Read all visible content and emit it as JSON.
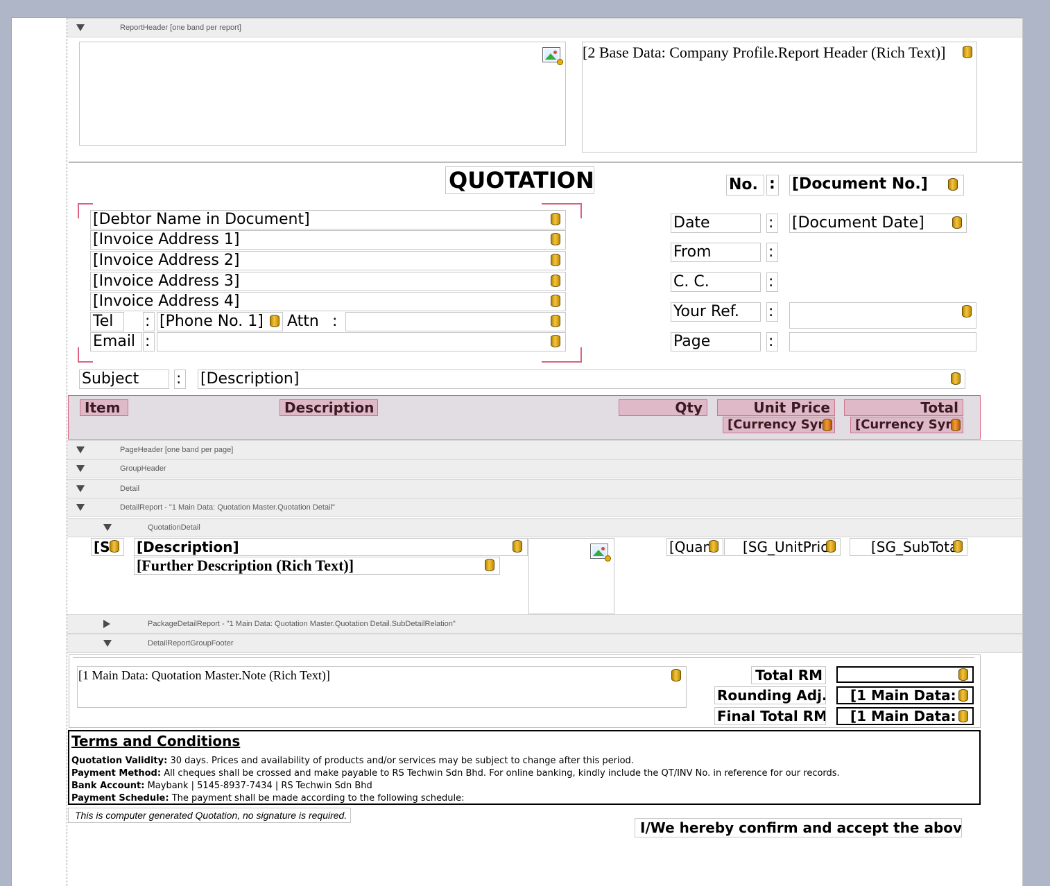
{
  "bands": {
    "report_header": "ReportHeader [one band per report]",
    "page_header": "PageHeader [one band per page]",
    "group_header": "GroupHeader",
    "detail": "Detail",
    "detail_report": "DetailReport - \"1 Main Data:  Quotation Master.Quotation Detail\"",
    "quotation_detail": "QuotationDetail",
    "package_detail_report": "PackageDetailReport - \"1 Main Data:  Quotation Master.Quotation Detail.SubDetailRelation\"",
    "detail_report_group_footer": "DetailReportGroupFooter"
  },
  "header": {
    "company_profile": "[2 Base Data:  Company Profile.Report Header (Rich Text)]",
    "title": "QUOTATION",
    "no_label": "No.",
    "colon": ":",
    "document_no": "[Document No.]"
  },
  "debtor": {
    "name": "[Debtor Name in Document]",
    "address1": "[Invoice Address 1]",
    "address2": "[Invoice Address 2]",
    "address3": "[Invoice Address 3]",
    "address4": "[Invoice Address 4]",
    "tel_label": "Tel",
    "phone": "[Phone No. 1]",
    "attn_label": "Attn",
    "email_label": "Email"
  },
  "doc_info": {
    "date_label": "Date",
    "date_value": "[Document Date]",
    "from_label": "From",
    "cc_label": "C. C.",
    "your_ref_label": "Your Ref.",
    "page_label": "Page"
  },
  "subject": {
    "label": "Subject",
    "value": "[Description]"
  },
  "columns": {
    "item": "Item",
    "description": "Description",
    "qty": "Qty",
    "unit_price": "Unit Price",
    "total": "Total",
    "currency_unit": "[Currency Sym",
    "currency_total": "[Currency Sym"
  },
  "detail_row": {
    "seq": "[S",
    "description": "[Description]",
    "further_description": "[Further Description (Rich Text)]",
    "qty": "[Quan",
    "unit_price": "[SG_UnitPric",
    "subtotal": "[SG_SubTota"
  },
  "footer": {
    "note": "[1 Main Data:  Quotation Master.Note (Rich Text)]",
    "total_label": "Total RM",
    "rounding_label": "Rounding Adj.",
    "rounding_value": "[1 Main Data:",
    "final_total_label": "Final Total RM",
    "final_total_value": "[1 Main Data:"
  },
  "terms": {
    "title": "Terms and Conditions",
    "validity_label": "Quotation Validity:",
    "validity_text": "30 days. Prices and availability of products and/or services may be subject to change after this period.",
    "payment_label": "Payment Method:",
    "payment_text": "All cheques shall be crossed and make payable to RS Techwin Sdn Bhd. For online banking, kindly include the QT/INV No. in reference for our records.",
    "bank_label": "Bank Account:",
    "bank_text": "Maybank | 5145-8937-7434 | RS Techwin Sdn Bhd",
    "schedule_label": "Payment Schedule:",
    "schedule_text": "The payment shall be made according to the following schedule:"
  },
  "computer_generated": "This is computer generated Quotation, no signature is required.",
  "confirm": "I/We hereby confirm and accept the above"
}
